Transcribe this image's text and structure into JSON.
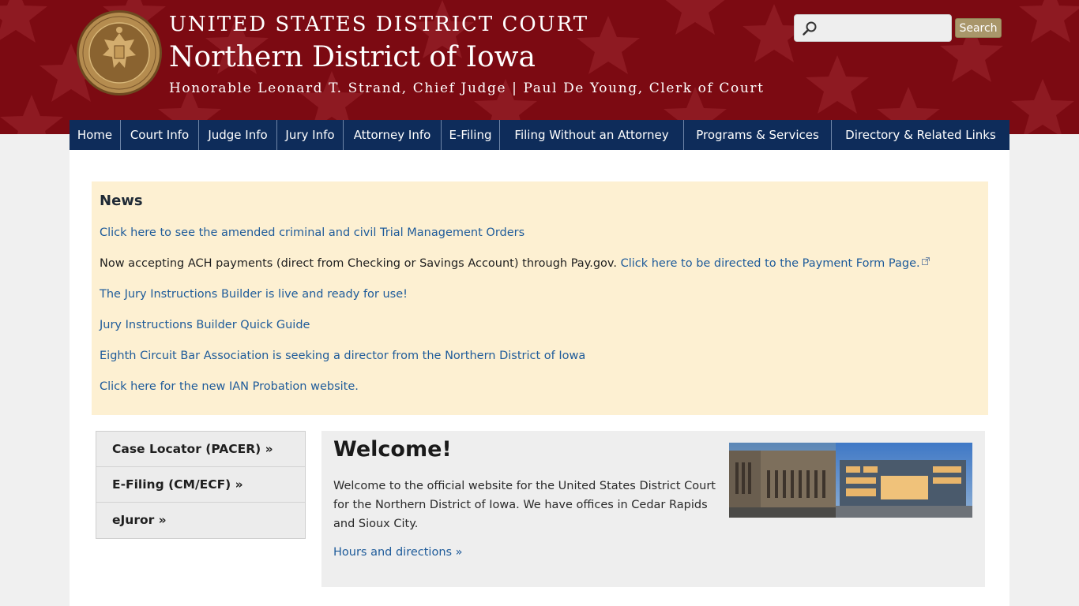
{
  "header": {
    "court_name": "UNITED STATES DISTRICT COURT",
    "district": "Northern District of Iowa",
    "officials": "Honorable Leonard T. Strand, Chief Judge | Paul De Young, Clerk of Court",
    "seal_icon": "court-seal-icon"
  },
  "search": {
    "value": "",
    "placeholder": "",
    "button_label": "Search"
  },
  "nav": {
    "items": [
      {
        "label": "Home"
      },
      {
        "label": "Court Info"
      },
      {
        "label": "Judge Info"
      },
      {
        "label": "Jury Info"
      },
      {
        "label": "Attorney Info"
      },
      {
        "label": "E-Filing"
      },
      {
        "label": "Filing Without an Attorney"
      },
      {
        "label": "Programs & Services"
      },
      {
        "label": "Directory & Related Links"
      }
    ]
  },
  "news": {
    "title": "News",
    "items": [
      {
        "link": "Click here to see the amended criminal and civil Trial Management Orders"
      },
      {
        "text": "Now accepting ACH payments (direct from Checking or Savings Account) through Pay.gov. ",
        "link": "Click here to be directed to the Payment Form Page."
      },
      {
        "link": "The Jury Instructions Builder is live and ready for use!"
      },
      {
        "link": "Jury Instructions Builder Quick Guide"
      },
      {
        "link": "Eighth Circuit Bar Association is seeking a director from the Northern District of Iowa"
      },
      {
        "link": "Click here for the new IAN Probation website."
      }
    ]
  },
  "quick_links": [
    {
      "label": "Case Locator (PACER) »"
    },
    {
      "label": "E-Filing (CM/ECF) »"
    },
    {
      "label": "eJuror »"
    }
  ],
  "welcome": {
    "title": "Welcome!",
    "body": "Welcome to the official website for the United States District Court for the Northern District of Iowa. We have offices in Cedar Rapids and Sioux City.",
    "hours_link": "Hours and directions »"
  },
  "colors": {
    "header_bg": "#7c0a12",
    "nav_bg": "#0e2c5a",
    "news_bg": "#fdf0d2",
    "link": "#1e5b9a",
    "search_button": "#a9966a"
  }
}
